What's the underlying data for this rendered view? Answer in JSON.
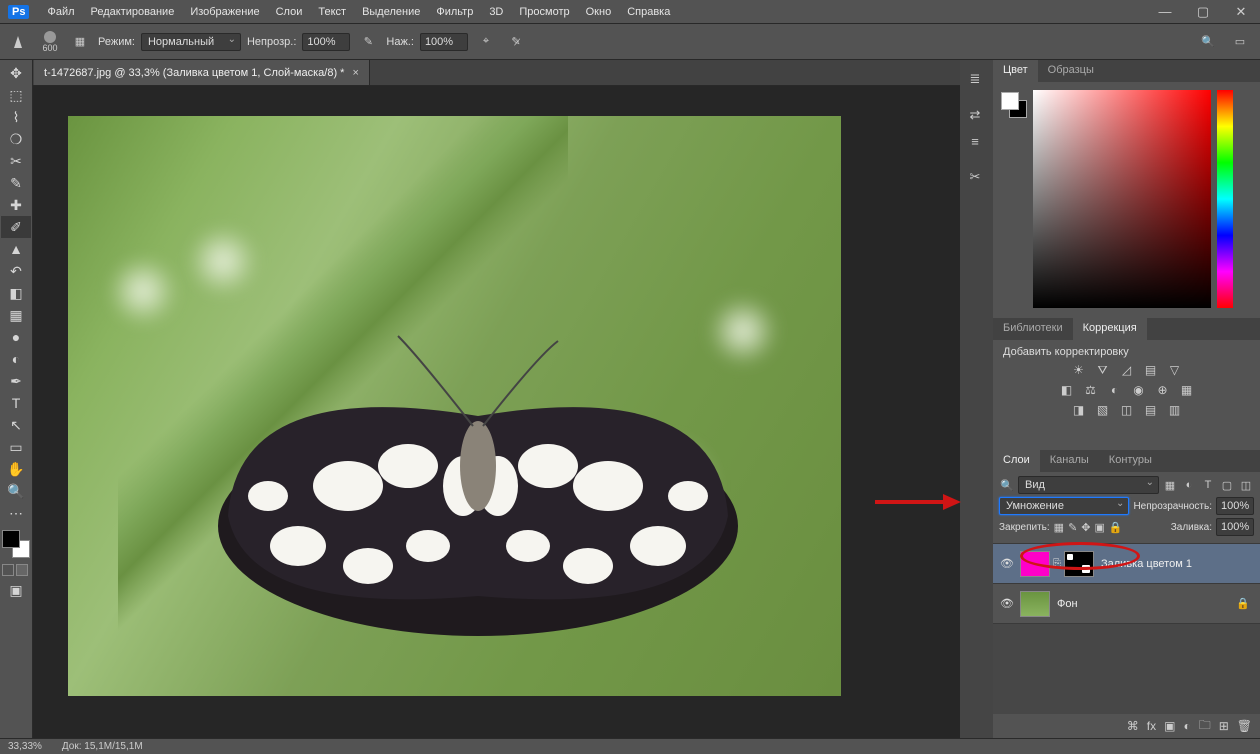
{
  "app": {
    "logo": "Ps"
  },
  "menu": [
    "Файл",
    "Редактирование",
    "Изображение",
    "Слои",
    "Текст",
    "Выделение",
    "Фильтр",
    "3D",
    "Просмотр",
    "Окно",
    "Справка"
  ],
  "options": {
    "brush_size": "600",
    "mode_label": "Режим:",
    "mode_value": "Нормальный",
    "opacity_label": "Непрозр.:",
    "opacity_value": "100%",
    "flow_label": "Наж.:",
    "flow_value": "100%"
  },
  "doc_tab": "t-1472687.jpg @ 33,3% (Заливка цветом 1, Слой-маска/8) *",
  "panel_tabs": {
    "color": "Цвет",
    "swatches": "Образцы",
    "libraries": "Библиотеки",
    "adjustments": "Коррекция",
    "layers": "Слои",
    "channels": "Каналы",
    "paths": "Контуры"
  },
  "adjustments": {
    "title": "Добавить корректировку"
  },
  "layers": {
    "search_label": "Вид",
    "blend_mode": "Умножение",
    "opacity_label": "Непрозрачность:",
    "opacity_value": "100%",
    "lock_label": "Закрепить:",
    "fill_label": "Заливка:",
    "fill_value": "100%",
    "items": [
      {
        "name": "Заливка цветом 1",
        "selected": true,
        "locked": false,
        "type": "fill"
      },
      {
        "name": "Фон",
        "selected": false,
        "locked": true,
        "type": "bg"
      }
    ]
  },
  "status": {
    "zoom": "33,33%",
    "doc": "Док: 15,1M/15,1M"
  }
}
